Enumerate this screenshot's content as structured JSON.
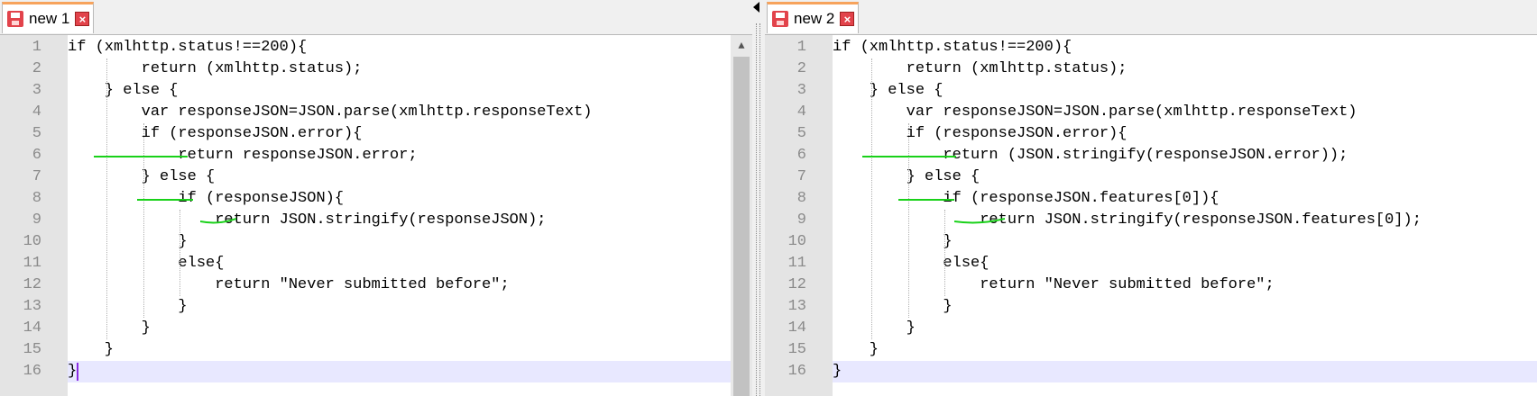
{
  "left": {
    "tab": {
      "label": "new 1",
      "save_icon": "save-icon",
      "close_icon": "close-icon",
      "close_glyph": "×"
    },
    "lines": [
      "if (xmlhttp.status!==200){",
      "        return (xmlhttp.status);",
      "    } else {",
      "        var responseJSON=JSON.parse(xmlhttp.responseText)",
      "        if (responseJSON.error){",
      "            return responseJSON.error;",
      "        } else {",
      "            if (responseJSON){",
      "                return JSON.stringify(responseJSON);",
      "            }",
      "            else{",
      "                return \"Never submitted before\";",
      "            }",
      "        }",
      "    }",
      "}"
    ],
    "current_line": 16
  },
  "right": {
    "tab": {
      "label": "new 2",
      "save_icon": "save-icon",
      "close_icon": "close-icon",
      "close_glyph": "×"
    },
    "lines": [
      "if (xmlhttp.status!==200){",
      "        return (xmlhttp.status);",
      "    } else {",
      "        var responseJSON=JSON.parse(xmlhttp.responseText)",
      "        if (responseJSON.error){",
      "            return (JSON.stringify(responseJSON.error));",
      "        } else {",
      "            if (responseJSON.features[0]){",
      "                return JSON.stringify(responseJSON.features[0]);",
      "            }",
      "            else{",
      "                return \"Never submitted before\";",
      "            }",
      "        }",
      "    }",
      "}"
    ],
    "current_line": 16
  },
  "line_numbers": [
    "1",
    "2",
    "3",
    "4",
    "5",
    "6",
    "7",
    "8",
    "9",
    "10",
    "11",
    "12",
    "13",
    "14",
    "15",
    "16"
  ],
  "colors": {
    "tab_accent": "#f7a35c",
    "diff_mark": "#19d119",
    "current_line": "#e8e8ff",
    "gutter": "#e4e4e4"
  },
  "scrollbar": {
    "up_glyph": "▲"
  }
}
